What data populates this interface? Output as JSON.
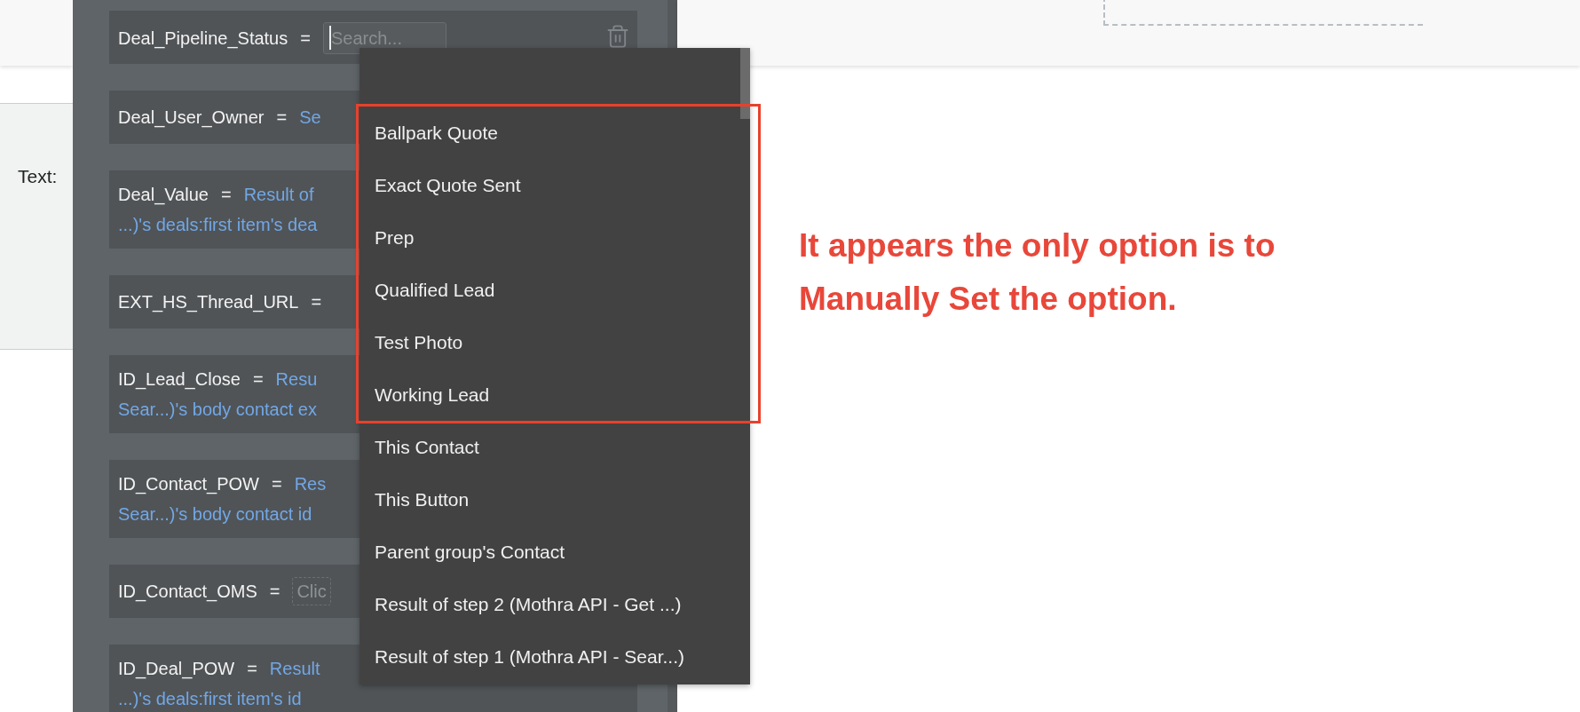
{
  "side_panel": {
    "label": "Text:"
  },
  "fields": [
    {
      "name": "Deal_Pipeline_Status",
      "operator": "=",
      "kind": "search",
      "placeholder": "Search..."
    },
    {
      "name": "Deal_User_Owner",
      "operator": "=",
      "kind": "text",
      "value": "Se"
    },
    {
      "name": "Deal_Value",
      "operator": "=",
      "kind": "text",
      "value": "Result of",
      "value_line2": "...)'s deals:first item's dea"
    },
    {
      "name": "EXT_HS_Thread_URL",
      "operator": "=",
      "kind": "none"
    },
    {
      "name": "ID_Lead_Close",
      "operator": "=",
      "kind": "text",
      "value": "Resu",
      "value_line2": "Sear...)'s body contact ex"
    },
    {
      "name": "ID_Contact_POW",
      "operator": "=",
      "kind": "text",
      "value": "Res",
      "value_line2": "Sear...)'s body contact id"
    },
    {
      "name": "ID_Contact_OMS",
      "operator": "=",
      "kind": "placeholder",
      "value": "Clic"
    },
    {
      "name": "ID_Deal_POW",
      "operator": "=",
      "kind": "text",
      "value": "Result",
      "value_line2": "...)'s deals:first item's id"
    }
  ],
  "dropdown": {
    "highlighted_options": [
      "Ballpark Quote",
      "Exact Quote Sent",
      "Prep",
      "Qualified Lead",
      "Test Photo",
      "Working Lead"
    ],
    "options": [
      "This Contact",
      "This Button",
      "Parent group's Contact",
      "Result of step 2 (Mothra API - Get ...)",
      "Result of step 1 (Mothra API - Sear...)"
    ]
  },
  "annotation": "It appears the only option is to Manually Set the option."
}
